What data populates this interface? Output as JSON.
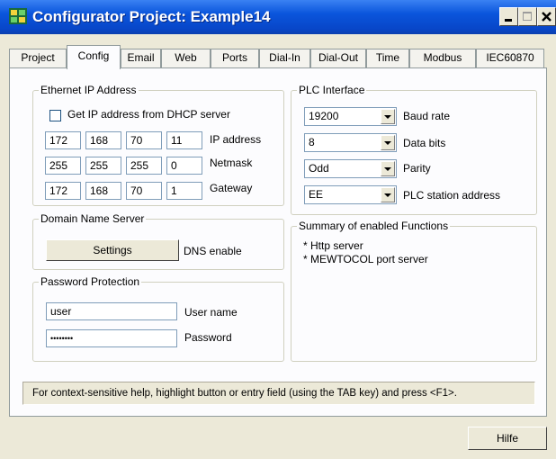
{
  "window": {
    "title": "Configurator Project: Example14"
  },
  "tabs": [
    {
      "label": "Project"
    },
    {
      "label": "Config"
    },
    {
      "label": "Email"
    },
    {
      "label": "Web"
    },
    {
      "label": "Ports"
    },
    {
      "label": "Dial-In"
    },
    {
      "label": "Dial-Out"
    },
    {
      "label": "Time"
    },
    {
      "label": "Modbus"
    },
    {
      "label": "IEC60870"
    }
  ],
  "active_tab": "Config",
  "ethernet": {
    "legend": "Ethernet IP Address",
    "dhcp_label": "Get IP address from DHCP server",
    "dhcp_checked": false,
    "ip_label": "IP address",
    "ip": [
      "172",
      "168",
      "70",
      "11"
    ],
    "netmask_label": "Netmask",
    "netmask": [
      "255",
      "255",
      "255",
      "0"
    ],
    "gateway_label": "Gateway",
    "gateway": [
      "172",
      "168",
      "70",
      "1"
    ]
  },
  "dns": {
    "legend": "Domain Name Server",
    "settings_button": "Settings",
    "enable_label": "DNS enable"
  },
  "password": {
    "legend": "Password Protection",
    "username_value": "user",
    "username_label": "User name",
    "password_value": "••••••••",
    "password_label": "Password"
  },
  "plc": {
    "legend": "PLC Interface",
    "baud_value": "19200",
    "baud_label": "Baud rate",
    "databits_value": "8",
    "databits_label": "Data bits",
    "parity_value": "Odd",
    "parity_label": "Parity",
    "station_value": "EE",
    "station_label": "PLC station address"
  },
  "summary": {
    "legend": "Summary of enabled Functions",
    "items": [
      "* Http server",
      "* MEWTOCOL port server"
    ]
  },
  "status_text": "For context-sensitive help, highlight button or entry field (using the TAB key) and press <F1>.",
  "help_button": "Hilfe",
  "colors": {
    "titlebar": "#0a55dc",
    "face": "#ece9d8",
    "panel": "#fcfcfe",
    "tab_border": "#919b9c",
    "field_border": "#7f9db9"
  }
}
